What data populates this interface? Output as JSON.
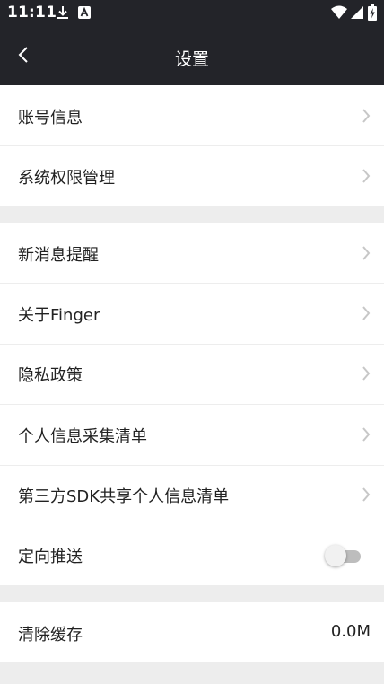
{
  "status_bar": {
    "time": "11:11",
    "left_icons": [
      "download-icon",
      "a-notification-icon"
    ],
    "right_icons": [
      "wifi-icon",
      "cellular-signal-icon",
      "battery-charging-icon"
    ]
  },
  "header": {
    "title": "设置",
    "back_icon": "chevron-left-icon"
  },
  "groups": [
    {
      "items": [
        {
          "label": "账号信息",
          "trailing": "chevron-right-icon"
        },
        {
          "label": "系统权限管理",
          "trailing": "chevron-right-icon"
        }
      ]
    },
    {
      "items": [
        {
          "label": "新消息提醒",
          "trailing": "chevron-right-icon"
        },
        {
          "label": "关于Finger",
          "trailing": "chevron-right-icon"
        },
        {
          "label": "隐私政策",
          "trailing": "chevron-right-icon"
        },
        {
          "label": "个人信息采集清单",
          "trailing": "chevron-right-icon"
        },
        {
          "label": "第三方SDK共享个人信息清单",
          "trailing": "chevron-right-icon"
        },
        {
          "label": "定向推送",
          "trailing": "toggle",
          "toggle_on": false
        }
      ]
    },
    {
      "items": [
        {
          "label": "清除缓存",
          "value": "0.0M"
        }
      ]
    }
  ],
  "colors": {
    "header_bg": "#232429",
    "page_bg": "#ededed",
    "row_bg": "#ffffff",
    "text": "#222222",
    "chevron": "#c7c7c7",
    "toggle_track_off": "#bdbdbd"
  }
}
